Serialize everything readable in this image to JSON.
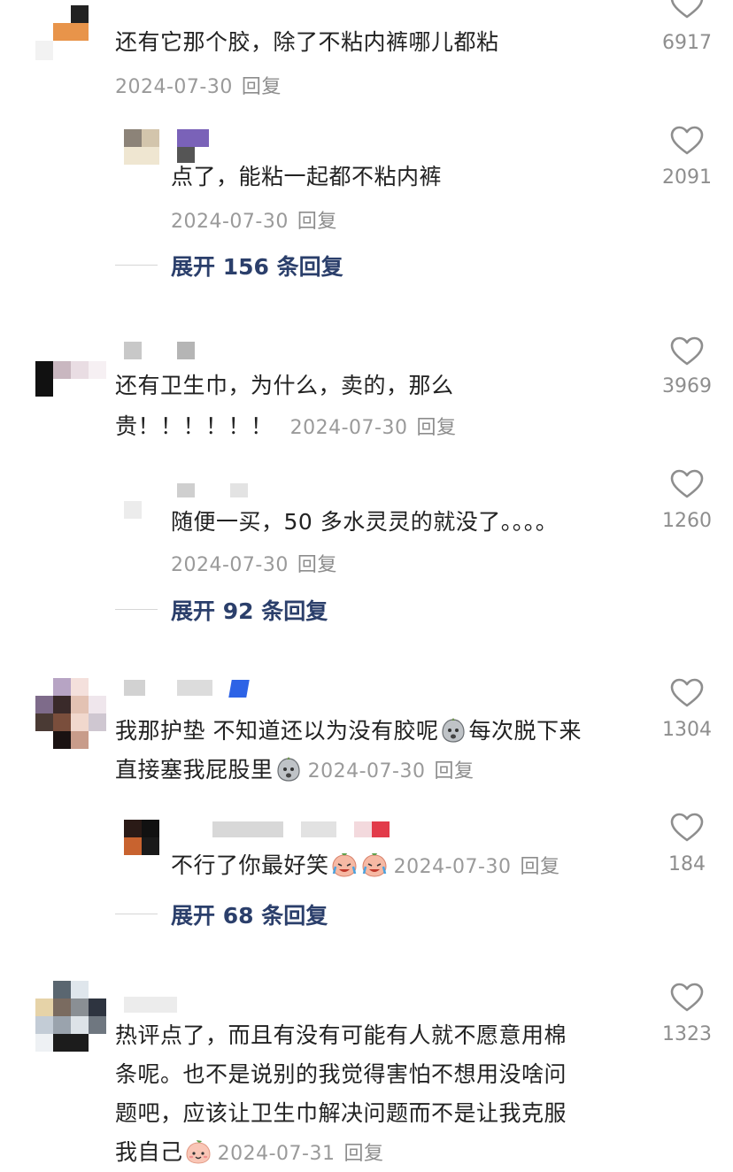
{
  "comments": [
    {
      "text_lines": [
        "还有它那个胶，除了不粘内裤哪儿都粘"
      ],
      "date": "2024-07-30",
      "reply_label": "回复",
      "likes": "6917",
      "replies": [
        {
          "text_lines": [
            "点了，能粘一起都不粘内裤"
          ],
          "date": "2024-07-30",
          "reply_label": "回复",
          "likes": "2091"
        }
      ],
      "expand_label": "展开 156 条回复"
    },
    {
      "text_lines": [
        "还有卫生巾，为什么，卖的，那么",
        "贵！！！！！！"
      ],
      "date": "2024-07-30",
      "reply_label": "回复",
      "likes": "3969",
      "replies": [
        {
          "text_lines": [
            "随便一买，50 多水灵灵的就没了。。。。"
          ],
          "date": "2024-07-30",
          "reply_label": "回复",
          "likes": "1260"
        }
      ],
      "expand_label": "展开 92 条回复"
    },
    {
      "text_lines": [
        "我那护垫 不知道还以为没有胶呢",
        "每次脱下来",
        "直接塞我屁股里"
      ],
      "date": "2024-07-30",
      "reply_label": "回复",
      "likes": "1304",
      "replies": [
        {
          "text_lines": [
            "不行了你最好笑"
          ],
          "date": "2024-07-30",
          "reply_label": "回复",
          "likes": "184"
        }
      ],
      "expand_label": "展开 68 条回复"
    },
    {
      "text_lines": [
        "热评点了，而且有没有可能有人就不愿意用棉",
        "条呢。也不是说别的我觉得害怕不想用没啥问",
        "题吧，应该让卫生巾解决问题而不是让我克服",
        "我自己"
      ],
      "date": "2024-07-31",
      "reply_label": "回复",
      "likes": "1323"
    }
  ],
  "icons": {
    "like": "heart-outline-icon",
    "emoji_grimace": "sweat-face-emoji",
    "emoji_laugh_cry": "laugh-cry-peach-emoji",
    "emoji_peach": "peach-face-emoji"
  },
  "colors": {
    "text": "#222222",
    "meta": "#9a9a9a",
    "expand": "#2b3f6b",
    "heart": "#8e8e8e"
  }
}
